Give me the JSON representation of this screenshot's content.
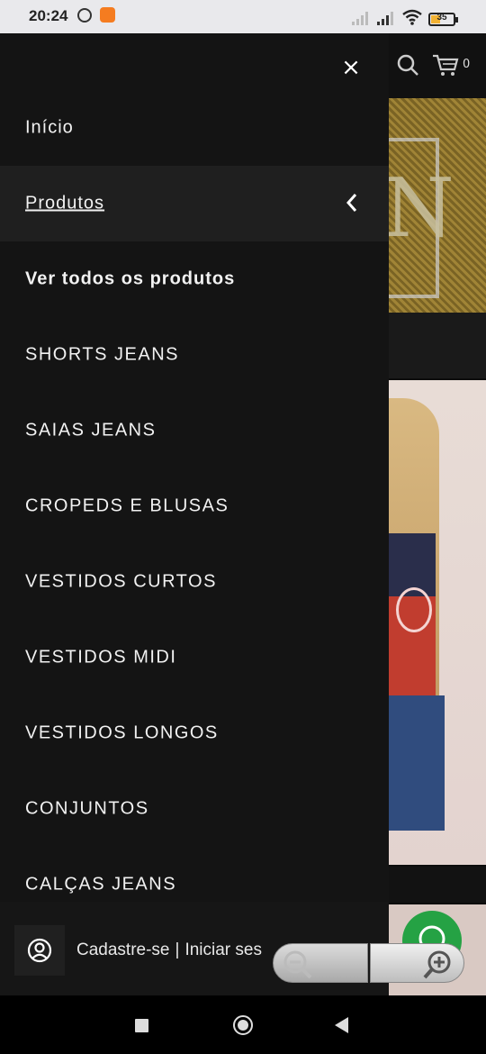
{
  "status_bar": {
    "time": "20:24",
    "battery": "35",
    "icons": [
      "alarm-icon",
      "app-notification-icon",
      "signal-icon",
      "signal-icon",
      "wifi-icon",
      "battery-icon"
    ]
  },
  "header": {
    "cart_count": "0",
    "icons": [
      "search-icon",
      "cart-icon"
    ]
  },
  "drawer": {
    "close_label": "×",
    "items": [
      {
        "label": "Início"
      },
      {
        "label": "Produtos",
        "expanded": true
      },
      {
        "label": "Ver todos os produtos"
      },
      {
        "label": "SHORTS JEANS"
      },
      {
        "label": "SAIAS JEANS"
      },
      {
        "label": "CROPEDS E BLUSAS"
      },
      {
        "label": "VESTIDOS CURTOS"
      },
      {
        "label": "VESTIDOS MIDI"
      },
      {
        "label": "VESTIDOS LONGOS"
      },
      {
        "label": "CONJUNTOS"
      },
      {
        "label": "CALÇAS JEANS"
      }
    ],
    "account": {
      "register": "Cadastre-se",
      "separator": "|",
      "login": "Iniciar ses"
    }
  },
  "colors": {
    "drawer_bg": "#141414",
    "active_bg": "#1f1f1f",
    "whatsapp": "#25a244"
  }
}
